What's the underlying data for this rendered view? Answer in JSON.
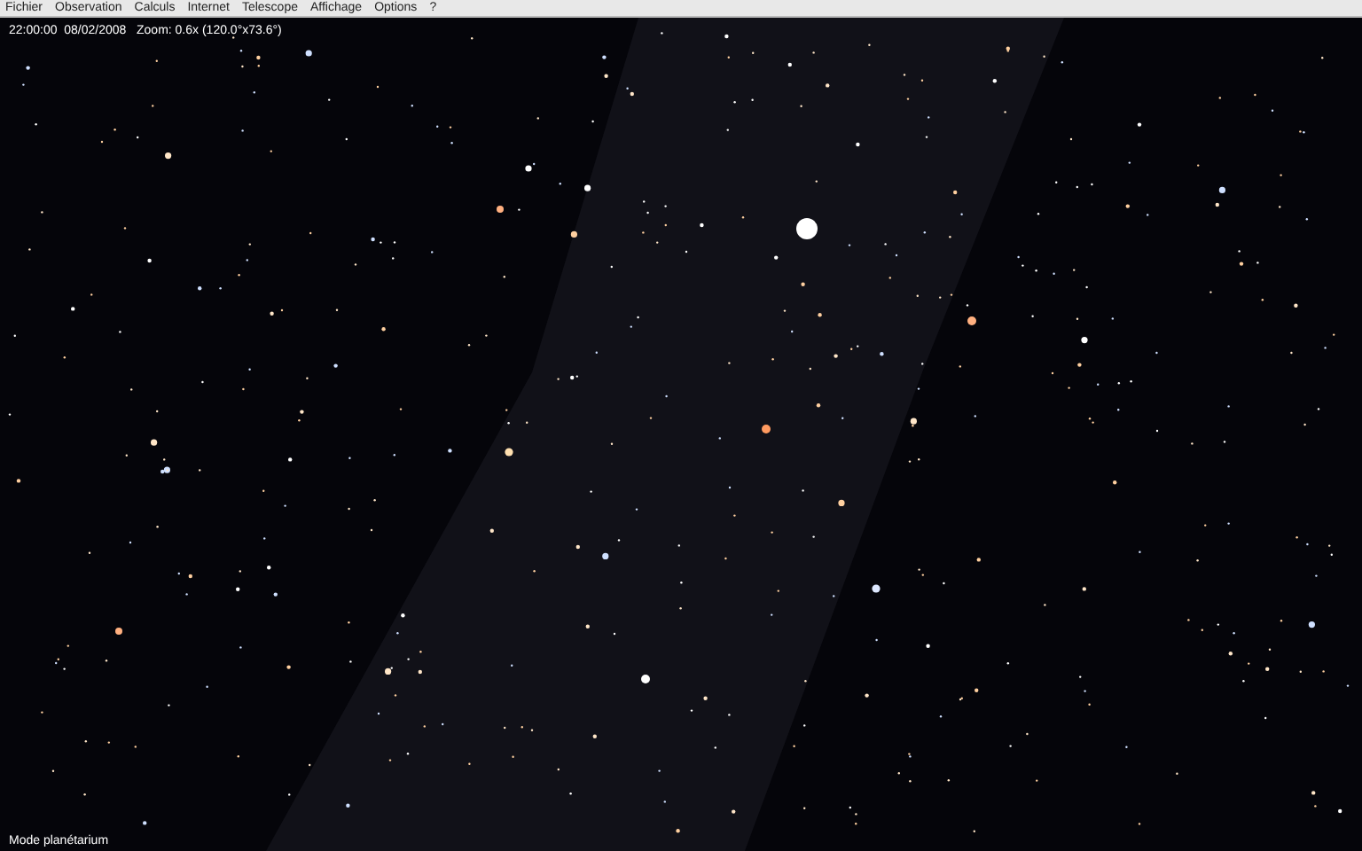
{
  "menu_bar": {
    "items": [
      "Fichier",
      "Observation",
      "Calculs",
      "Internet",
      "Telescope",
      "Affichage",
      "Options",
      "?"
    ]
  },
  "sky_view": {
    "info": "22:00:00  08/02/2008   Zoom: 0.6x (120.0°x73.6°)",
    "mode": "Mode planétarium"
  }
}
